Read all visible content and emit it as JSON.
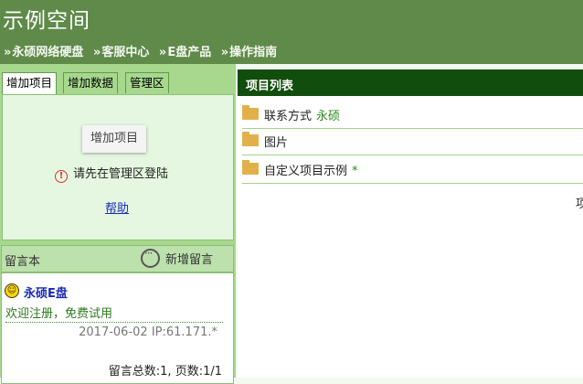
{
  "site_title": "示例空间",
  "nav": {
    "separator": "»",
    "items": [
      "永硕网络硬盘",
      "客服中心",
      "E盘产品",
      "操作指南"
    ]
  },
  "tabs": [
    "增加项目",
    "增加数据",
    "管理区"
  ],
  "add_panel": {
    "add_button": "增加项目",
    "warning": "请先在管理区登陆",
    "help": "帮助"
  },
  "guestbook": {
    "title": "留言本",
    "new_label": "新增留言",
    "message": {
      "user": "永硕E盘",
      "text": "欢迎注册，免费试用",
      "meta": "2017-06-02 IP:61.171.*"
    },
    "total": "留言总数:1, 页数:1/1"
  },
  "list": {
    "title": "项目列表",
    "rows": [
      {
        "label": "联系方式",
        "extra": "永硕"
      },
      {
        "label": "图片",
        "extra": ""
      },
      {
        "label": "自定义项目示例",
        "extra": "*"
      }
    ],
    "cut_text": "项"
  },
  "colors": {
    "header_bg": "#5f8a4a",
    "list_header_bg": "#114d0c",
    "tab_bg": "#a7d88e",
    "folder": "#e2b04a",
    "link": "#1a2bb5"
  }
}
